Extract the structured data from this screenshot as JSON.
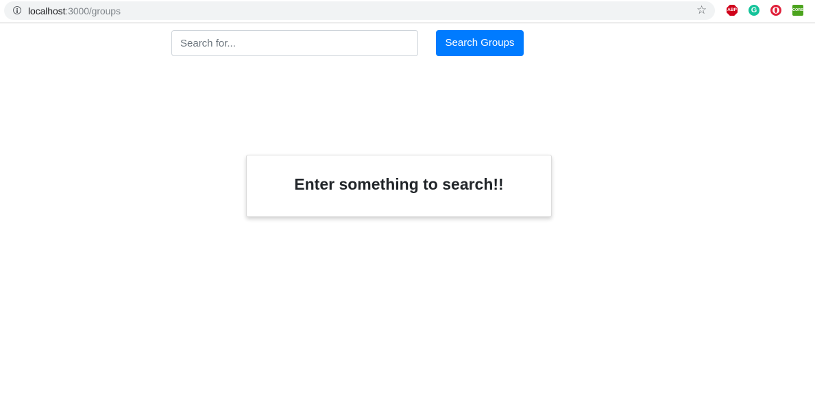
{
  "browser": {
    "url_host": "localhost",
    "url_path": ":3000/groups",
    "extensions": {
      "abp_label": "ABP",
      "grammarly_label": "G",
      "cors_label": "CORS"
    }
  },
  "search": {
    "placeholder": "Search for...",
    "value": "",
    "button_label": "Search Groups"
  },
  "message": {
    "text": "Enter something to search!!"
  },
  "colors": {
    "primary": "#007bff",
    "text": "#212529"
  },
  "icons": {
    "info": "info-icon",
    "bookmark": "star-icon",
    "adblock": "adblock-plus-icon",
    "grammarly": "grammarly-icon",
    "opera": "opera-icon",
    "cors": "cors-icon"
  }
}
